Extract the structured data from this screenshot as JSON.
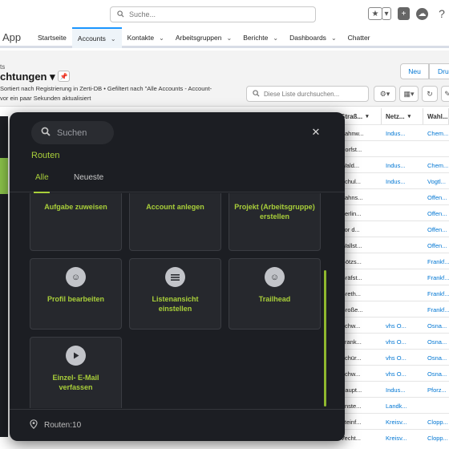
{
  "topbar": {
    "search_placeholder": "Suche...",
    "icons": [
      "favorites-star-icon",
      "chevron-down-icon",
      "plus-icon",
      "cloud-icon",
      "help-icon"
    ]
  },
  "nav": {
    "app_name": "App",
    "tabs": [
      {
        "label": "Startseite",
        "has_menu": false,
        "active": false
      },
      {
        "label": "Accounts",
        "has_menu": true,
        "active": true
      },
      {
        "label": "Kontakte",
        "has_menu": true,
        "active": false
      },
      {
        "label": "Arbeitsgruppen",
        "has_menu": true,
        "active": false
      },
      {
        "label": "Berichte",
        "has_menu": true,
        "active": false
      },
      {
        "label": "Dashboards",
        "has_menu": true,
        "active": false
      },
      {
        "label": "Chatter",
        "has_menu": false,
        "active": false
      }
    ]
  },
  "header": {
    "object_label": "ts",
    "list_title": "chtungen",
    "subtitle_line1": "Sortiert nach Registrierung in Zerti-DB • Gefiltert nach \"Alle Accounts - Account-",
    "subtitle_line2": "vor ein paar Sekunden aktualisiert",
    "new_button": "Neu",
    "print_button": "Dru",
    "list_search_placeholder": "Diese Liste durchsuchen..."
  },
  "table": {
    "columns": [
      "Straß...",
      "Netz...",
      "Wahl..."
    ],
    "rows": [
      [
        "Bahnw...",
        "Indus...",
        "Chem..."
      ],
      [
        "Dorfst...",
        "",
        ""
      ],
      [
        "Wald...",
        "Indus...",
        "Chem..."
      ],
      [
        "Schul...",
        "Indus...",
        "Vogtl..."
      ],
      [
        "Bahns...",
        "",
        "Offen..."
      ],
      [
        "Berlin...",
        "",
        "Offen..."
      ],
      [
        "Vor d...",
        "",
        "Offen..."
      ],
      [
        "Wallst...",
        "",
        "Offen..."
      ],
      [
        "Götzs...",
        "",
        "Frankf..."
      ],
      [
        "Gräfst...",
        "",
        "Frankf..."
      ],
      [
        "Greth...",
        "",
        "Frankf..."
      ],
      [
        "Große...",
        "",
        "Frankf..."
      ],
      [
        "Schw...",
        "vhs O...",
        "Osna..."
      ],
      [
        "Krank...",
        "vhs O...",
        "Osna..."
      ],
      [
        "Schür...",
        "vhs O...",
        "Osna..."
      ],
      [
        "Schw...",
        "vhs O...",
        "Osna..."
      ],
      [
        "Haupt...",
        "Indus...",
        "Pforz..."
      ],
      [
        "Enste...",
        "Landk...",
        ""
      ],
      [
        "Steinf...",
        "Kreisv...",
        "Clopp..."
      ],
      [
        "Vecht...",
        "Kreisv...",
        "Clopp..."
      ]
    ]
  },
  "overlay": {
    "search_placeholder": "Suchen",
    "heading": "Routen",
    "tabs": [
      "Alle",
      "Neueste"
    ],
    "tiles": [
      {
        "label": "Aufgabe zuweisen",
        "icon": "smiley-icon"
      },
      {
        "label": "Account anlegen",
        "icon": "smiley-icon"
      },
      {
        "label": "Projekt (Arbeitsgruppe) erstellen",
        "icon": "smiley-icon"
      },
      {
        "label": "Profil bearbeiten",
        "icon": "smiley-icon"
      },
      {
        "label": "Listenansicht einstellen",
        "icon": "list-icon"
      },
      {
        "label": "Trailhead",
        "icon": "smiley-icon"
      },
      {
        "label": "Einzel- E-Mail verfassen",
        "icon": "play-icon"
      }
    ],
    "footer": "Routen:10"
  },
  "colors": {
    "accent_green": "#a9cf3a",
    "overlay_bg": "#1c1e23",
    "link_blue": "#0176d3"
  }
}
